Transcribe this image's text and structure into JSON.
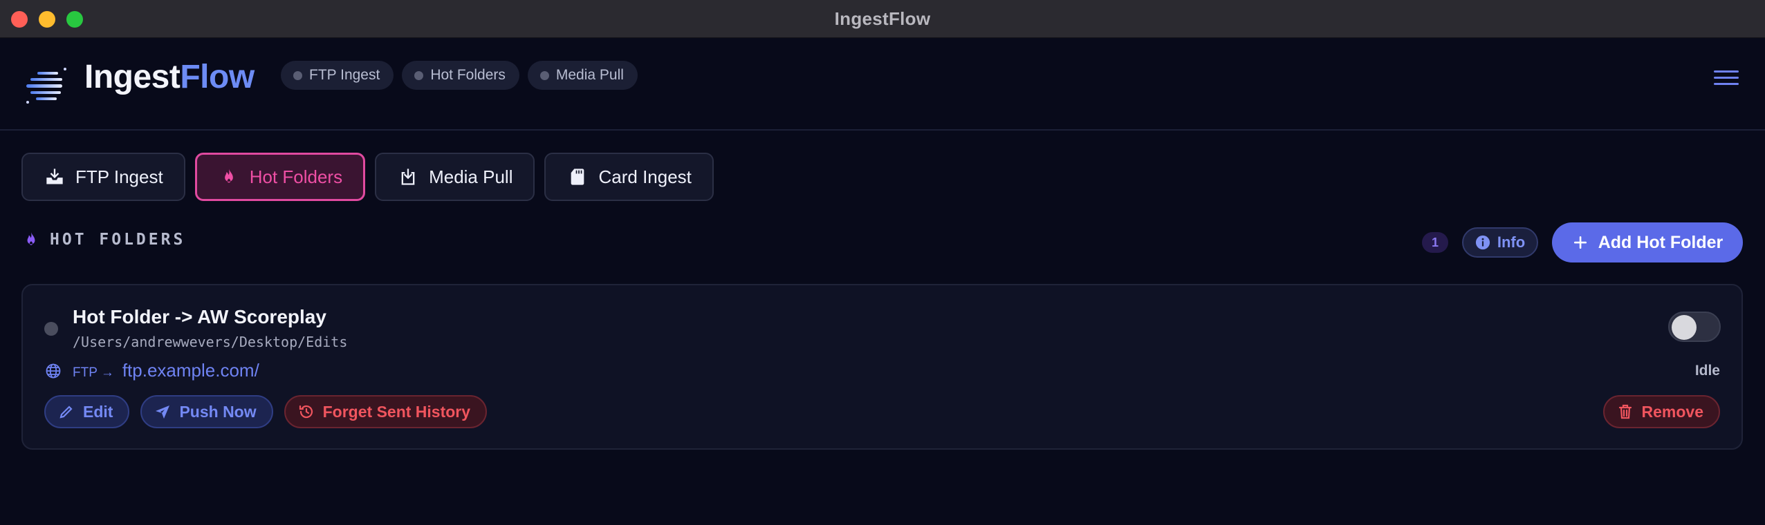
{
  "window": {
    "title": "IngestFlow"
  },
  "header": {
    "logo_part1": "Ingest",
    "logo_part2": "Flow",
    "status_chips": [
      {
        "label": "FTP Ingest"
      },
      {
        "label": "Hot Folders"
      },
      {
        "label": "Media Pull"
      }
    ]
  },
  "tabs": [
    {
      "label": "FTP Ingest",
      "icon": "inbox-tray-icon"
    },
    {
      "label": "Hot Folders",
      "icon": "flame-icon",
      "active": true
    },
    {
      "label": "Media Pull",
      "icon": "download-box-icon"
    },
    {
      "label": "Card Ingest",
      "icon": "sd-card-icon"
    }
  ],
  "section": {
    "title": "HOT FOLDERS",
    "count": "1",
    "info_label": "Info",
    "add_label": "Add Hot Folder"
  },
  "hot_folder": {
    "title": "Hot Folder -> AW Scoreplay",
    "path": "/Users/andrewwevers/Desktop/Edits",
    "protocol": "FTP →",
    "destination": "ftp.example.com/",
    "status": "Idle",
    "enabled": false,
    "actions": {
      "edit": "Edit",
      "push": "Push Now",
      "forget": "Forget Sent History",
      "remove": "Remove"
    }
  },
  "colors": {
    "background": "#080a1a",
    "accent": "#5b6ae8",
    "active_tab": "#e04aa0",
    "danger": "#f0555e"
  }
}
